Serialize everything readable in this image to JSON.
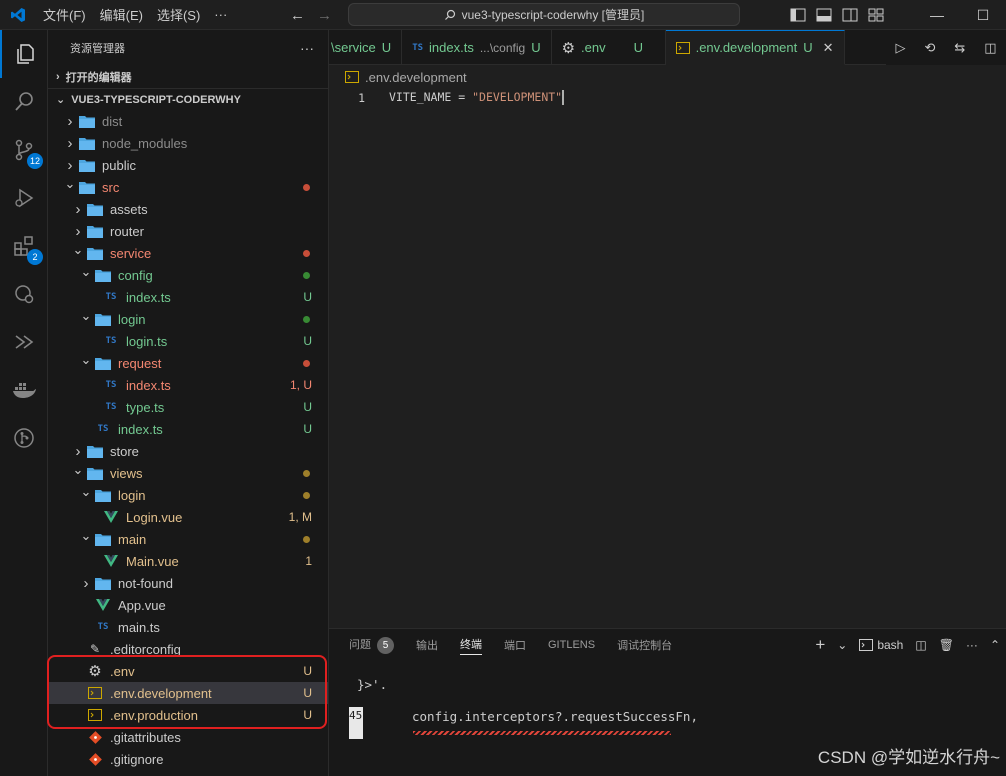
{
  "titlebar": {
    "menus": [
      "文件(F)",
      "编辑(E)",
      "选择(S)",
      "···"
    ],
    "search_text": "vue3-typescript-coderwhy [管理员]"
  },
  "activity": {
    "scm_badge": "12",
    "extensions_badge": "2"
  },
  "sidebar": {
    "title": "资源管理器",
    "more": "···",
    "open_editors": "打开的编辑器",
    "root": "VUE3-TYPESCRIPT-CODERWHY",
    "rows": [
      {
        "label": "dist",
        "status": ""
      },
      {
        "label": "node_modules",
        "status": ""
      },
      {
        "label": "public",
        "status": ""
      },
      {
        "label": "src",
        "status": ""
      },
      {
        "label": "assets",
        "status": ""
      },
      {
        "label": "router",
        "status": ""
      },
      {
        "label": "service",
        "status": ""
      },
      {
        "label": "config",
        "status": ""
      },
      {
        "label": "index.ts",
        "status": "U"
      },
      {
        "label": "login",
        "status": ""
      },
      {
        "label": "login.ts",
        "status": "U"
      },
      {
        "label": "request",
        "status": ""
      },
      {
        "label": "index.ts",
        "status": "1, U"
      },
      {
        "label": "type.ts",
        "status": "U"
      },
      {
        "label": "index.ts",
        "status": "U"
      },
      {
        "label": "store",
        "status": ""
      },
      {
        "label": "views",
        "status": ""
      },
      {
        "label": "login",
        "status": ""
      },
      {
        "label": "Login.vue",
        "status": "1, M"
      },
      {
        "label": "main",
        "status": ""
      },
      {
        "label": "Main.vue",
        "status": "1"
      },
      {
        "label": "not-found",
        "status": ""
      },
      {
        "label": "App.vue",
        "status": ""
      },
      {
        "label": "main.ts",
        "status": ""
      },
      {
        "label": ".editorconfig",
        "status": ""
      },
      {
        "label": ".env",
        "status": "U"
      },
      {
        "label": ".env.development",
        "status": "U"
      },
      {
        "label": ".env.production",
        "status": "U"
      },
      {
        "label": ".gitattributes",
        "status": ""
      },
      {
        "label": ".gitignore",
        "status": ""
      }
    ]
  },
  "tabs": [
    {
      "label": "\\service",
      "desc": "",
      "status": "U"
    },
    {
      "label": "index.ts",
      "desc": "...\\config",
      "status": "U"
    },
    {
      "label": ".env",
      "desc": "",
      "status": "U"
    },
    {
      "label": ".env.development",
      "desc": "",
      "status": "U"
    }
  ],
  "editor": {
    "breadcrumb": ".env.development",
    "line_number": "1",
    "code_key": "VITE_NAME = ",
    "code_value": "\"DEVELOPMENT\""
  },
  "panel": {
    "tabs": [
      "问题",
      "输出",
      "终端",
      "端口",
      "GITLENS",
      "调试控制台"
    ],
    "problems_count": "5",
    "shell": "bash",
    "term_line1": "}>'.",
    "term_line_number": "45",
    "term_line2": "config.interceptors?.requestSuccessFn,"
  },
  "watermark": "CSDN @学如逆水行舟~"
}
